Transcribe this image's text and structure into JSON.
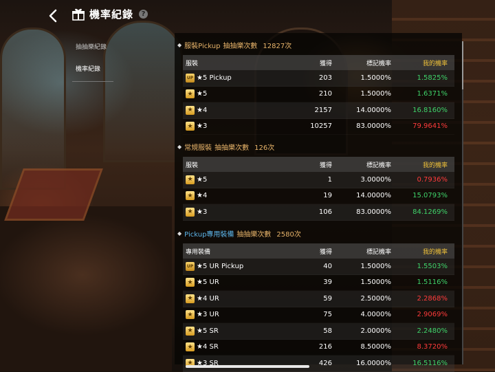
{
  "header": {
    "title": "機率紀錄",
    "help": "?"
  },
  "nav": {
    "items": [
      {
        "label": "抽抽樂紀錄",
        "active": false
      },
      {
        "label": "機率紀錄",
        "active": true
      }
    ]
  },
  "sections": [
    {
      "title_prefix": "服裝Pickup",
      "title_suffix": "抽抽樂次數",
      "count": "12827次",
      "headers": {
        "name": "服裝",
        "get": "獲得",
        "rate": "標記機率",
        "mine": "我的機率"
      },
      "rows": [
        {
          "icon": "UP",
          "name": "★5 Pickup",
          "get": "203",
          "rate": "1.5000%",
          "mine": "1.5825%",
          "status": "green"
        },
        {
          "icon": "★",
          "name": "★5",
          "get": "210",
          "rate": "1.5000%",
          "mine": "1.6371%",
          "status": "green"
        },
        {
          "icon": "★",
          "name": "★4",
          "get": "2157",
          "rate": "14.0000%",
          "mine": "16.8160%",
          "status": "green"
        },
        {
          "icon": "★",
          "name": "★3",
          "get": "10257",
          "rate": "83.0000%",
          "mine": "79.9641%",
          "status": "red"
        }
      ]
    },
    {
      "title_prefix": "常規服裝",
      "title_suffix": "抽抽樂次數",
      "count": "126次",
      "headers": {
        "name": "服裝",
        "get": "獲得",
        "rate": "標記機率",
        "mine": "我的機率"
      },
      "rows": [
        {
          "icon": "★",
          "name": "★5",
          "get": "1",
          "rate": "3.0000%",
          "mine": "0.7936%",
          "status": "red"
        },
        {
          "icon": "★",
          "name": "★4",
          "get": "19",
          "rate": "14.0000%",
          "mine": "15.0793%",
          "status": "green"
        },
        {
          "icon": "★",
          "name": "★3",
          "get": "106",
          "rate": "83.0000%",
          "mine": "84.1269%",
          "status": "green"
        }
      ]
    },
    {
      "title_prefix": "Pickup專用裝備",
      "title_suffix": "抽抽樂次數",
      "count": "2580次",
      "headers": {
        "name": "專用裝備",
        "get": "獲得",
        "rate": "標記機率",
        "mine": "我的機率"
      },
      "rows": [
        {
          "icon": "UP",
          "name": "★5 UR Pickup",
          "get": "40",
          "rate": "1.5000%",
          "mine": "1.5503%",
          "status": "green"
        },
        {
          "icon": "★",
          "name": "★5 UR",
          "get": "39",
          "rate": "1.5000%",
          "mine": "1.5116%",
          "status": "green"
        },
        {
          "icon": "★",
          "name": "★4 UR",
          "get": "59",
          "rate": "2.5000%",
          "mine": "2.2868%",
          "status": "red"
        },
        {
          "icon": "★",
          "name": "★3 UR",
          "get": "75",
          "rate": "4.0000%",
          "mine": "2.9069%",
          "status": "red"
        },
        {
          "icon": "★",
          "name": "★5 SR",
          "get": "58",
          "rate": "2.0000%",
          "mine": "2.2480%",
          "status": "green"
        },
        {
          "icon": "★",
          "name": "★4 SR",
          "get": "216",
          "rate": "8.5000%",
          "mine": "8.3720%",
          "status": "red"
        },
        {
          "icon": "★",
          "name": "★3 SR",
          "get": "426",
          "rate": "16.0000%",
          "mine": "16.5116%",
          "status": "green"
        }
      ]
    }
  ],
  "colors": {
    "above_marked": "#3fd36a",
    "below_marked": "#ff3b3b",
    "section_title": "#e8b46a",
    "pickup_highlight": "#5cb4e8",
    "my_rate_header": "#f0c23a"
  }
}
